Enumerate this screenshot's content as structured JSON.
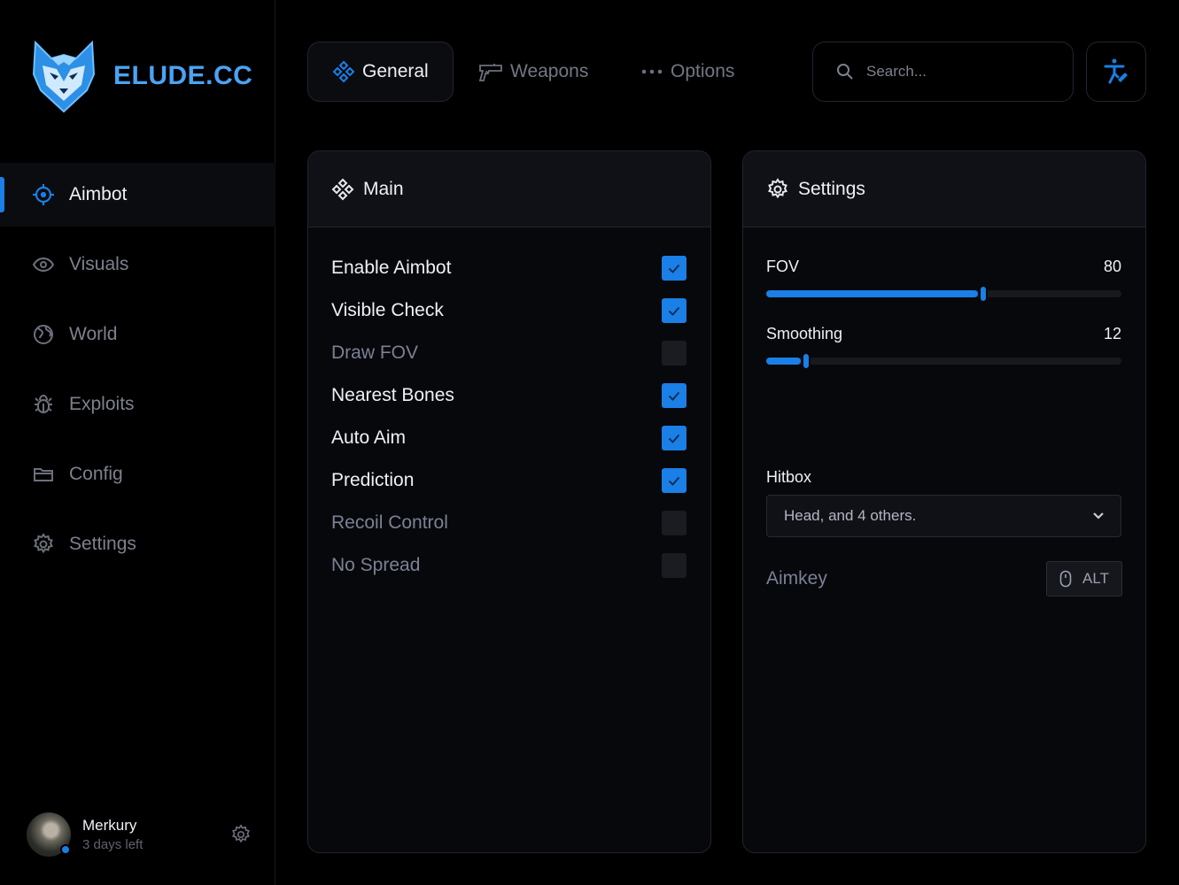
{
  "brand": {
    "name": "ELUDE.CC"
  },
  "sidebar": {
    "items": [
      {
        "label": "Aimbot",
        "icon": "crosshair-icon",
        "active": true
      },
      {
        "label": "Visuals",
        "icon": "eye-icon",
        "active": false
      },
      {
        "label": "World",
        "icon": "globe-icon",
        "active": false
      },
      {
        "label": "Exploits",
        "icon": "bug-icon",
        "active": false
      },
      {
        "label": "Config",
        "icon": "folder-icon",
        "active": false
      },
      {
        "label": "Settings",
        "icon": "gear-icon",
        "active": false
      }
    ],
    "user": {
      "name": "Merkury",
      "subscription": "3 days left",
      "status": "online"
    }
  },
  "tabs": [
    {
      "label": "General",
      "icon": "component-icon",
      "active": true
    },
    {
      "label": "Weapons",
      "icon": "pistol-icon",
      "active": false
    },
    {
      "label": "Options",
      "icon": "ellipsis-icon",
      "active": false
    }
  ],
  "search": {
    "placeholder": "Search...",
    "value": ""
  },
  "main_panel": {
    "title": "Main",
    "options": [
      {
        "label": "Enable Aimbot",
        "checked": true
      },
      {
        "label": "Visible Check",
        "checked": true
      },
      {
        "label": "Draw FOV",
        "checked": false
      },
      {
        "label": "Nearest Bones",
        "checked": true
      },
      {
        "label": "Auto Aim",
        "checked": true
      },
      {
        "label": "Prediction",
        "checked": true
      },
      {
        "label": "Recoil Control",
        "checked": false
      },
      {
        "label": "No Spread",
        "checked": false
      }
    ]
  },
  "settings_panel": {
    "title": "Settings",
    "fov": {
      "label": "FOV",
      "value": "80",
      "fraction": 0.61
    },
    "smoothing": {
      "label": "Smoothing",
      "value": "12",
      "fraction": 0.112
    },
    "hitbox": {
      "label": "Hitbox",
      "value": "Head, and 4 others."
    },
    "aimkey": {
      "label": "Aimkey",
      "key": "ALT"
    }
  },
  "colors": {
    "accent": "#1a7fe6",
    "brand": "#4aa3f2",
    "background": "#000000"
  }
}
